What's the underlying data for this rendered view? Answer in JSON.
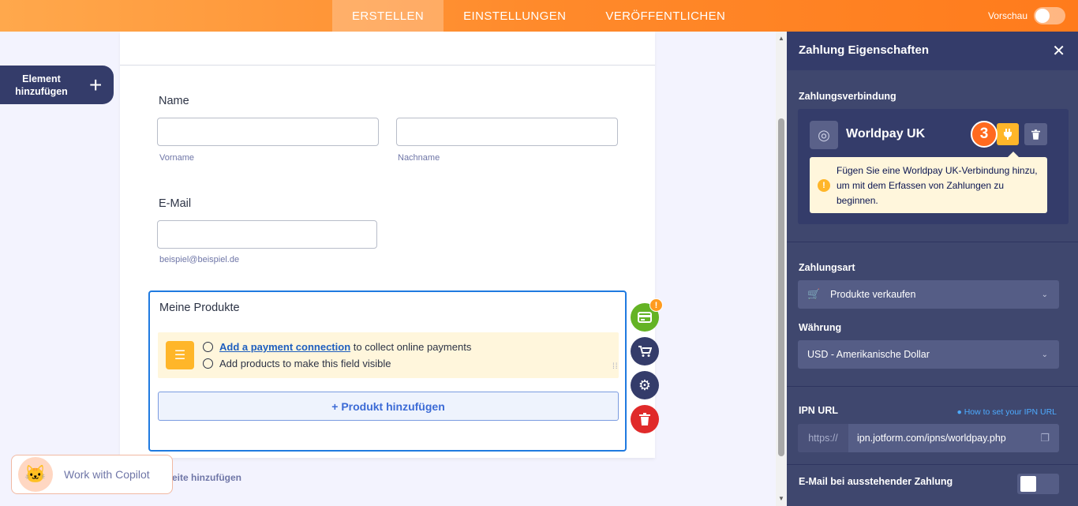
{
  "topbar": {
    "tabs": [
      {
        "label": "ERSTELLEN",
        "active": true
      },
      {
        "label": "EINSTELLUNGEN",
        "active": false
      },
      {
        "label": "VERÖFFENTLICHEN",
        "active": false
      }
    ],
    "preview_label": "Vorschau",
    "preview_on": false
  },
  "left": {
    "add_element_line1": "Element",
    "add_element_line2": "hinzufügen"
  },
  "form": {
    "name_label": "Name",
    "first_sublabel": "Vorname",
    "last_sublabel": "Nachname",
    "email_label": "E-Mail",
    "email_sublabel": "beispiel@beispiel.de",
    "products": {
      "title": "Meine Produkte",
      "link": "Add a payment connection",
      "line1_rest": " to collect online payments",
      "line2": "Add products to make this field visible",
      "add_button": "+ Produkt hinzufügen"
    },
    "fab_badge": "!",
    "add_page": "eite hinzufügen"
  },
  "copilot": {
    "label": "Work with Copilot"
  },
  "panel": {
    "title": "Zahlung Eigenschaften",
    "connection_section": "Zahlungsverbindung",
    "gateway_name": "Worldpay UK",
    "step_number": "3",
    "tip": "Fügen Sie eine Worldpay UK-Verbindung hinzu, um mit dem Erfassen von Zahlungen zu beginnen.",
    "payment_type_label": "Zahlungsart",
    "payment_type_value": "Produkte verkaufen",
    "currency_label": "Währung",
    "currency_value": "USD - Amerikanische Dollar",
    "ipn_label": "IPN URL",
    "ipn_help": "How to set your IPN URL",
    "ipn_prefix": "https://",
    "ipn_value": "ipn.jotform.com/ipns/worldpay.php",
    "pending_email_label": "E-Mail bei ausstehender Zahlung"
  },
  "colors": {
    "accent": "#ff7b1c",
    "panel": "#3f476e",
    "link": "#1f5fbf"
  }
}
